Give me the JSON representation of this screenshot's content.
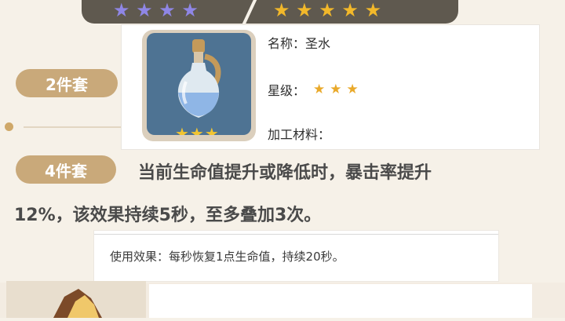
{
  "banner": {
    "left_stars": "★ ★ ★ ★",
    "right_stars": "★ ★ ★ ★ ★",
    "left_star_color": "#8f86e6",
    "right_star_color": "#f2b82a"
  },
  "sets": {
    "two_piece_label": "2件套",
    "four_piece_label": "4件套",
    "four_piece_desc_line1": "当前生命值提升或降低时，暴击率提升",
    "four_piece_desc_line2": "12%，该效果持续5秒，至多叠加3次。"
  },
  "item": {
    "icon": "holy-water-bottle-icon",
    "icon_stars": "★★★",
    "name_label": "名称：",
    "name_value": "圣水",
    "rarity_label": "星级：",
    "rarity_stars": "★★★",
    "material_label": "加工材料："
  },
  "effect": {
    "text": "使用效果：每秒恢复1点生命值，持续20秒。"
  }
}
